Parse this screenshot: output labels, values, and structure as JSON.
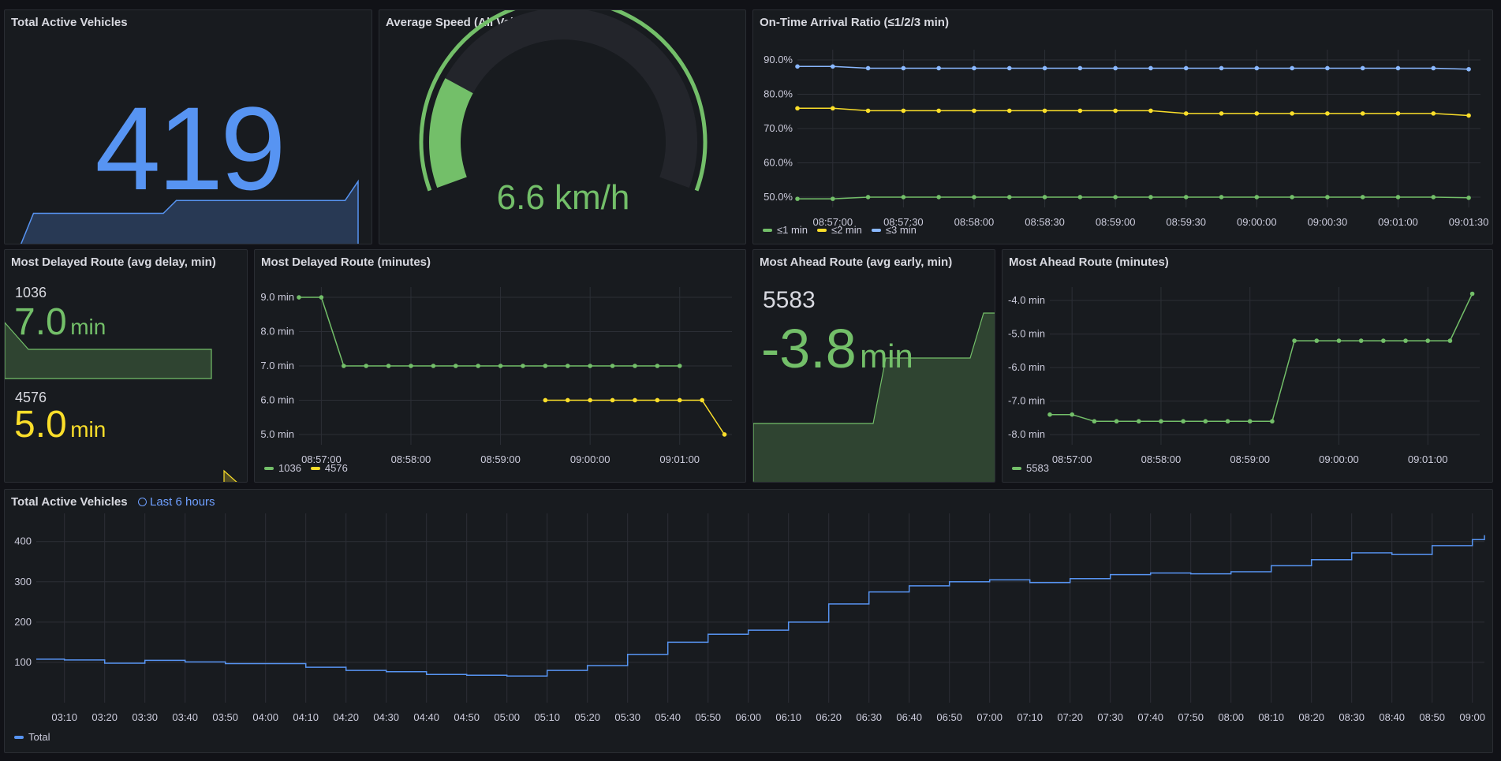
{
  "colors": {
    "blue": "#5794f2",
    "green": "#73bf69",
    "yellow": "#fade2a",
    "grid": "#2c2f36",
    "axis_text": "#ccccdc"
  },
  "panels": {
    "active_vehicles_stat": {
      "title": "Total Active Vehicles",
      "value": "419",
      "sparkline_values": [
        0,
        0.45,
        0.45,
        0.45,
        0.45,
        0.45,
        0.45,
        0.45,
        0.45,
        0.45,
        0.45,
        0.45,
        0.63,
        0.63,
        0.63,
        0.63,
        0.63,
        0.63,
        0.63,
        0.63,
        0.63,
        0.63,
        0.63,
        0.63,
        0.63,
        0.63,
        0.9
      ]
    },
    "avg_speed_gauge": {
      "title": "Average Speed (All Vehicles)",
      "value": "6.6 km/h",
      "fill_fraction": 0.22
    },
    "on_time_ratio": {
      "title": "On-Time Arrival Ratio (≤1/2/3 min)",
      "legend": [
        "≤1 min",
        "≤2 min",
        "≤3 min"
      ]
    },
    "most_delayed_stat": {
      "title": "Most Delayed Route (avg delay, min)",
      "items": [
        {
          "route": "1036",
          "value": "7.0",
          "unit": "min"
        },
        {
          "route": "4576",
          "value": "5.0",
          "unit": "min"
        }
      ]
    },
    "most_delayed_chart": {
      "title": "Most Delayed Route (minutes)",
      "legend": [
        "1036",
        "4576"
      ]
    },
    "most_ahead_stat": {
      "title": "Most Ahead Route (avg early, min)",
      "route": "5583",
      "value": "-3.8",
      "unit": "min"
    },
    "most_ahead_chart": {
      "title": "Most Ahead Route (minutes)",
      "legend": [
        "5583"
      ]
    },
    "active_vehicles_history": {
      "title": "Total Active Vehicles",
      "time_range": "Last 6 hours",
      "legend": [
        "Total"
      ]
    }
  },
  "chart_data": [
    {
      "id": "on_time_ratio",
      "type": "line",
      "title": "On-Time Arrival Ratio (≤1/2/3 min)",
      "x_tick_labels": [
        "08:57:00",
        "08:57:30",
        "08:58:00",
        "08:58:30",
        "08:59:00",
        "08:59:30",
        "09:00:00",
        "09:00:30",
        "09:01:00",
        "09:01:30"
      ],
      "y_tick_labels": [
        "90.0%",
        "80.0%",
        "70.0%",
        "60.0%",
        "50.0%"
      ],
      "x": [
        "08:56:45",
        "08:57:00",
        "08:57:15",
        "08:57:30",
        "08:57:45",
        "08:58:00",
        "08:58:15",
        "08:58:30",
        "08:58:45",
        "08:59:00",
        "08:59:15",
        "08:59:30",
        "08:59:45",
        "09:00:00",
        "09:00:15",
        "09:00:30",
        "09:00:45",
        "09:01:00",
        "09:01:15",
        "09:01:30"
      ],
      "ylim": [
        47,
        93
      ],
      "series": [
        {
          "name": "≤1 min",
          "color": "#73bf69",
          "values": [
            49.5,
            49.5,
            50,
            50,
            50,
            50,
            50,
            50,
            50,
            50,
            50,
            50,
            50,
            50,
            50,
            50,
            50,
            50,
            50,
            49.8
          ]
        },
        {
          "name": "≤2 min",
          "color": "#fade2a",
          "values": [
            75.9,
            75.9,
            75.2,
            75.2,
            75.2,
            75.2,
            75.2,
            75.2,
            75.2,
            75.2,
            75.2,
            74.4,
            74.4,
            74.4,
            74.4,
            74.4,
            74.4,
            74.4,
            74.4,
            73.8
          ]
        },
        {
          "name": "≤3 min",
          "color": "#8ab8ff",
          "values": [
            88.1,
            88.1,
            87.6,
            87.6,
            87.6,
            87.6,
            87.6,
            87.6,
            87.6,
            87.6,
            87.6,
            87.6,
            87.6,
            87.6,
            87.6,
            87.6,
            87.6,
            87.6,
            87.6,
            87.3
          ]
        }
      ]
    },
    {
      "id": "most_delayed_chart",
      "type": "line",
      "title": "Most Delayed Route (minutes)",
      "x_tick_labels": [
        "08:57:00",
        "08:58:00",
        "08:59:00",
        "09:00:00",
        "09:01:00"
      ],
      "y_tick_labels": [
        "9.0 min",
        "8.0 min",
        "7.0 min",
        "6.0 min",
        "5.0 min"
      ],
      "x": [
        "08:56:45",
        "08:57:00",
        "08:57:15",
        "08:57:30",
        "08:57:45",
        "08:58:00",
        "08:58:15",
        "08:58:30",
        "08:58:45",
        "08:59:00",
        "08:59:15",
        "08:59:30",
        "08:59:45",
        "09:00:00",
        "09:00:15",
        "09:00:30",
        "09:00:45",
        "09:01:00",
        "09:01:15",
        "09:01:30"
      ],
      "ylim": [
        4.7,
        9.3
      ],
      "series": [
        {
          "name": "1036",
          "color": "#73bf69",
          "values": [
            9,
            9,
            7,
            7,
            7,
            7,
            7,
            7,
            7,
            7,
            7,
            7,
            7,
            7,
            7,
            7,
            7,
            7,
            null,
            null
          ]
        },
        {
          "name": "4576",
          "color": "#fade2a",
          "values": [
            null,
            null,
            null,
            null,
            null,
            null,
            null,
            null,
            null,
            null,
            null,
            6,
            6,
            6,
            6,
            6,
            6,
            6,
            6,
            5
          ]
        }
      ]
    },
    {
      "id": "most_ahead_chart",
      "type": "line",
      "title": "Most Ahead Route (minutes)",
      "x_tick_labels": [
        "08:57:00",
        "08:58:00",
        "08:59:00",
        "09:00:00",
        "09:01:00"
      ],
      "y_tick_labels": [
        "-4.0 min",
        "-5.0 min",
        "-6.0 min",
        "-7.0 min",
        "-8.0 min"
      ],
      "x": [
        "08:56:45",
        "08:57:00",
        "08:57:15",
        "08:57:30",
        "08:57:45",
        "08:58:00",
        "08:58:15",
        "08:58:30",
        "08:58:45",
        "08:59:00",
        "08:59:15",
        "08:59:30",
        "08:59:45",
        "09:00:00",
        "09:00:15",
        "09:00:30",
        "09:00:45",
        "09:01:00",
        "09:01:15",
        "09:01:30"
      ],
      "ylim": [
        -8.3,
        -3.6
      ],
      "series": [
        {
          "name": "5583",
          "color": "#73bf69",
          "values": [
            -7.4,
            -7.4,
            -7.6,
            -7.6,
            -7.6,
            -7.6,
            -7.6,
            -7.6,
            -7.6,
            -7.6,
            -7.6,
            -5.2,
            -5.2,
            -5.2,
            -5.2,
            -5.2,
            -5.2,
            -5.2,
            -5.2,
            -3.8
          ]
        }
      ]
    },
    {
      "id": "active_vehicles_history",
      "type": "line",
      "title": "Total Active Vehicles",
      "x_tick_labels": [
        "03:10",
        "03:20",
        "03:30",
        "03:40",
        "03:50",
        "04:00",
        "04:10",
        "04:20",
        "04:30",
        "04:40",
        "04:50",
        "05:00",
        "05:10",
        "05:20",
        "05:30",
        "05:40",
        "05:50",
        "06:00",
        "06:10",
        "06:20",
        "06:30",
        "06:40",
        "06:50",
        "07:00",
        "07:10",
        "07:20",
        "07:30",
        "07:40",
        "07:50",
        "08:00",
        "08:10",
        "08:20",
        "08:30",
        "08:40",
        "08:50",
        "09:00"
      ],
      "y_tick_labels": [
        "400",
        "300",
        "200",
        "100"
      ],
      "ylim": [
        0,
        470
      ],
      "series": [
        {
          "name": "Total",
          "color": "#5794f2",
          "x": [
            "03:03",
            "03:10",
            "03:20",
            "03:30",
            "03:40",
            "03:50",
            "04:00",
            "04:10",
            "04:20",
            "04:30",
            "04:40",
            "04:50",
            "05:00",
            "05:10",
            "05:20",
            "05:30",
            "05:40",
            "05:50",
            "06:00",
            "06:10",
            "06:20",
            "06:30",
            "06:40",
            "06:50",
            "07:00",
            "07:10",
            "07:20",
            "07:30",
            "07:40",
            "07:50",
            "08:00",
            "08:10",
            "08:20",
            "08:30",
            "08:40",
            "08:50",
            "09:00",
            "09:03"
          ],
          "values": [
            108,
            106,
            98,
            105,
            101,
            97,
            97,
            88,
            80,
            77,
            70,
            68,
            66,
            80,
            92,
            120,
            150,
            170,
            180,
            200,
            245,
            275,
            290,
            300,
            305,
            298,
            308,
            318,
            322,
            320,
            325,
            340,
            355,
            372,
            368,
            390,
            405,
            416
          ]
        }
      ]
    }
  ]
}
